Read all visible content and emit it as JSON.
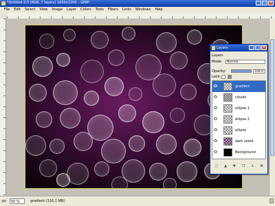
{
  "window": {
    "title": "*Untitled-2.0 (RGB, 7 layers) 1600x1200 – GIMP",
    "minimize": "_",
    "maximize": "□",
    "close": "×"
  },
  "menu": [
    "File",
    "Edit",
    "Select",
    "View",
    "Image",
    "Layer",
    "Colors",
    "Tools",
    "Filters",
    "Links",
    "Windows",
    "Help"
  ],
  "status": {
    "unit": "px",
    "zoom": "50 %",
    "layer_info": "gradient (116.1 MB)"
  },
  "layers_dock": {
    "title": "Layers",
    "tab": "Layers",
    "mode_label": "Mode:",
    "mode_value": "Normal",
    "opacity_label": "Opacity:",
    "opacity_value": "100.0",
    "lock_label": "Lock:",
    "layers": [
      {
        "name": "gradient",
        "selected": true,
        "thumb": "checker"
      },
      {
        "name": "clouds",
        "selected": false,
        "thumb": "clouds"
      },
      {
        "name": "ellipse 1",
        "selected": false,
        "thumb": "checker"
      },
      {
        "name": "ellipse 2",
        "selected": false,
        "thumb": "checker"
      },
      {
        "name": "ellipse",
        "selected": false,
        "thumb": "checker"
      },
      {
        "name": "dark violet",
        "selected": false,
        "thumb": "violet"
      },
      {
        "name": "Background",
        "selected": false,
        "thumb": "black"
      }
    ]
  },
  "colors": {
    "accent": "#316ac5",
    "canvas_center": "#6a1d60",
    "canvas_edge": "#050205"
  }
}
